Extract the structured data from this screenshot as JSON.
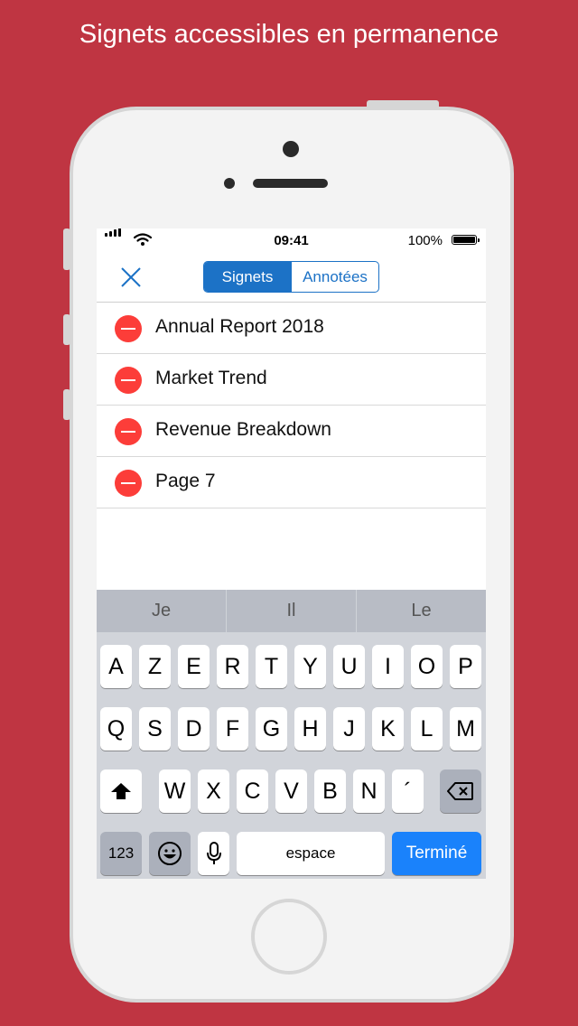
{
  "caption": "Signets accessibles en permanence",
  "status": {
    "time": "09:41",
    "battery": "100%"
  },
  "nav": {
    "tabs": [
      {
        "label": "Signets",
        "active": true
      },
      {
        "label": "Annotées",
        "active": false
      }
    ]
  },
  "bookmarks": [
    {
      "title": "Annual Report 2018"
    },
    {
      "title": "Market Trend"
    },
    {
      "title": "Revenue Breakdown"
    },
    {
      "title": "Page 7"
    }
  ],
  "keyboard": {
    "predictions": [
      "Je",
      "Il",
      "Le"
    ],
    "row1": [
      "A",
      "Z",
      "E",
      "R",
      "T",
      "Y",
      "U",
      "I",
      "O",
      "P"
    ],
    "row2": [
      "Q",
      "S",
      "D",
      "F",
      "G",
      "H",
      "J",
      "K",
      "L",
      "M"
    ],
    "row3": [
      "W",
      "X",
      "C",
      "V",
      "B",
      "N",
      "´"
    ],
    "numbers_label": "123",
    "space_label": "espace",
    "done_label": "Terminé"
  },
  "colors": {
    "background": "#bf3542",
    "accent": "#1c72c6",
    "delete": "#fc3d39",
    "done_key": "#1a82fb"
  }
}
